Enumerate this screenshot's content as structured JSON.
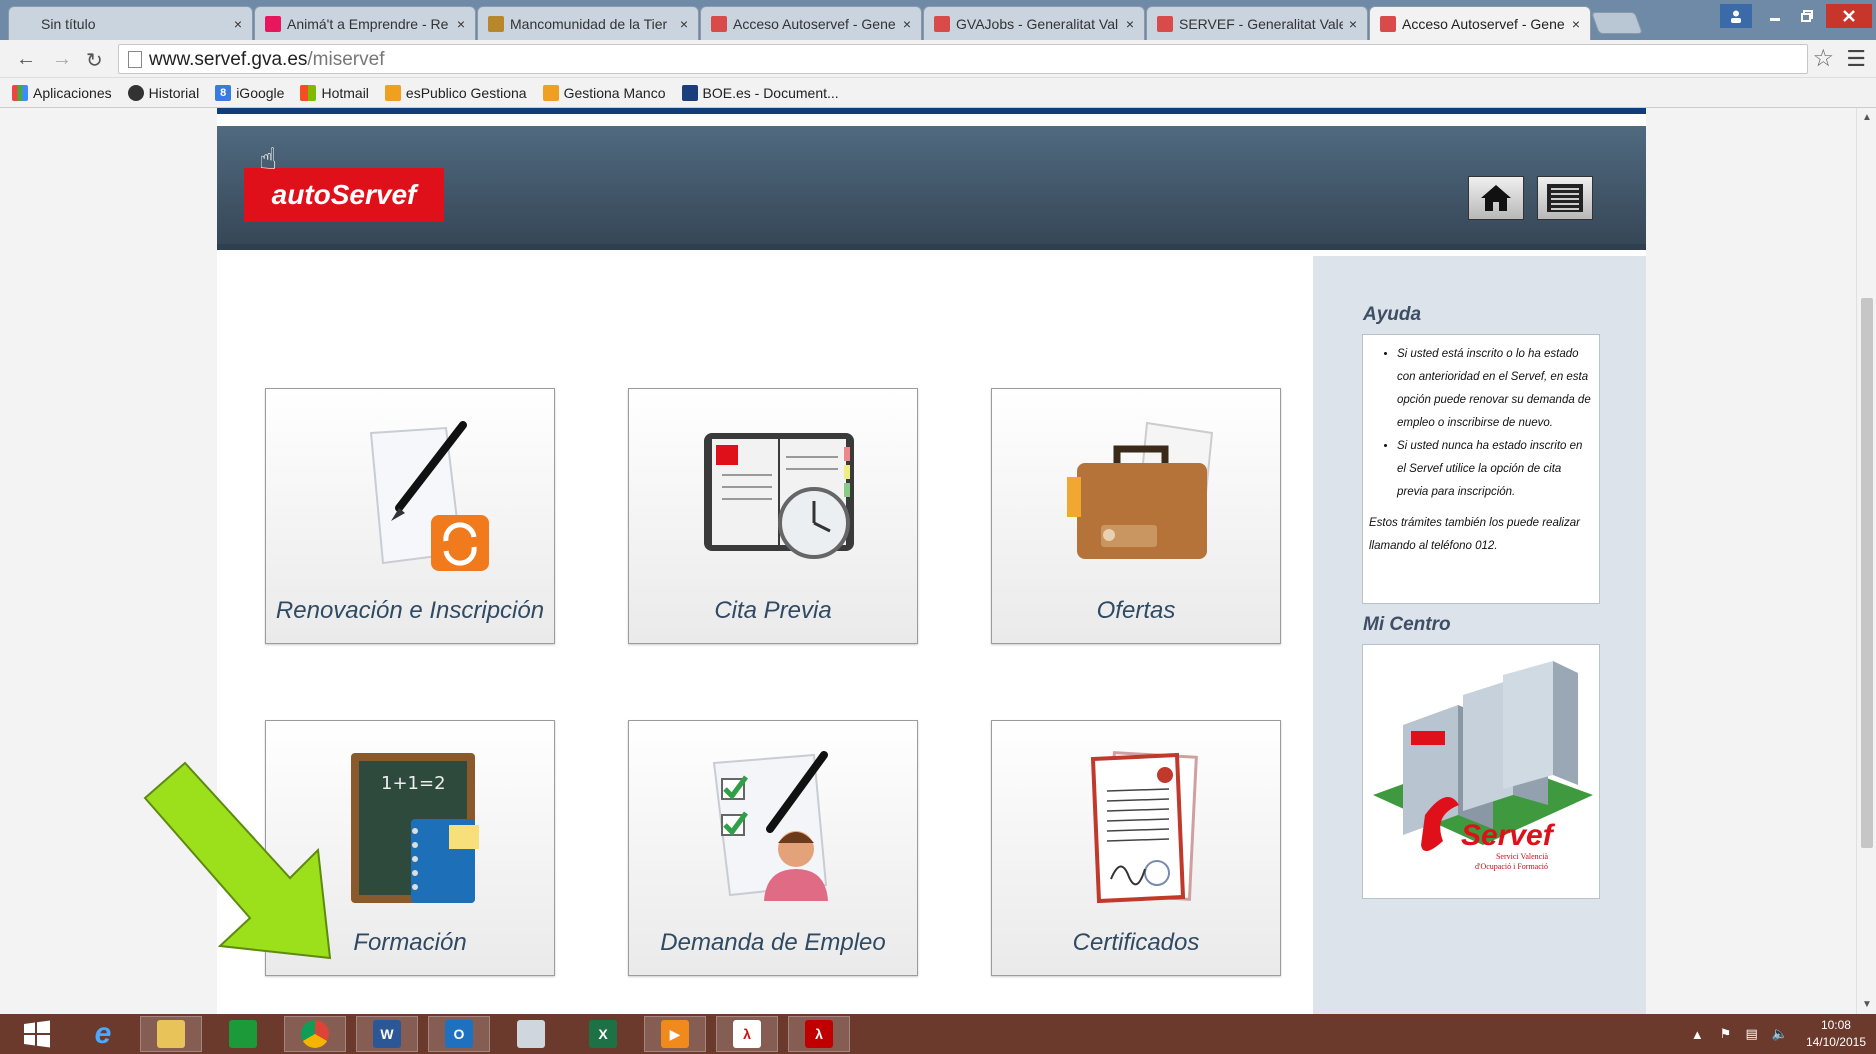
{
  "browser": {
    "tabs": [
      {
        "title": "Sin título",
        "active": false
      },
      {
        "title": "Animá't a Emprendre - Re",
        "active": false
      },
      {
        "title": "Mancomunidad de la Tier",
        "active": false
      },
      {
        "title": "Acceso Autoservef - Gene",
        "active": false
      },
      {
        "title": "GVAJobs - Generalitat Val",
        "active": false
      },
      {
        "title": "SERVEF - Generalitat Valen",
        "active": false
      },
      {
        "title": "Acceso Autoservef - Gene",
        "active": true
      }
    ],
    "close_glyph": "×",
    "url_host": "www.servef.gva.es",
    "url_path": "/miservef",
    "bookmarks": [
      {
        "label": "Aplicaciones",
        "icon": "apps-grid-icon"
      },
      {
        "label": "Historial",
        "icon": "history-icon"
      },
      {
        "label": "iGoogle",
        "icon": "igoogle-icon"
      },
      {
        "label": "Hotmail",
        "icon": "windows-flag-icon"
      },
      {
        "label": "esPublico Gestiona",
        "icon": "espublico-icon"
      },
      {
        "label": "Gestiona Manco",
        "icon": "espublico-icon"
      },
      {
        "label": "BOE.es - Document...",
        "icon": "boe-icon"
      }
    ]
  },
  "site": {
    "logo_text": "autoServef",
    "tiles": [
      {
        "label": "Renovación e Inscripción",
        "icon": "renewal-document-icon"
      },
      {
        "label": "Cita Previa",
        "icon": "agenda-clock-icon"
      },
      {
        "label": "Ofertas",
        "icon": "briefcase-icon"
      },
      {
        "label": "Formación",
        "icon": "chalkboard-icon"
      },
      {
        "label": "Demanda de Empleo",
        "icon": "checklist-person-icon"
      },
      {
        "label": "Certificados",
        "icon": "certificate-icon"
      }
    ],
    "sidebar": {
      "help_title": "Ayuda",
      "help_items": [
        "Si usted está inscrito o lo ha estado con anterioridad en el Servef, en esta opción puede renovar su demanda de empleo o inscribirse de nuevo.",
        "Si usted nunca ha estado inscrito en el Servef utilice la opción de cita previa para inscripción."
      ],
      "help_note": "Estos trámites también los puede realizar llamando al teléfono 012.",
      "centro_title": "Mi Centro",
      "centro_brand": "Servef",
      "centro_sub1": "Servici Valencià",
      "centro_sub2": "d'Ocupació i Formació"
    },
    "colors": {
      "brand_red": "#e0101a",
      "banner": "#44576a",
      "sidebar": "#dde3ea",
      "arrow_green": "#9be01a"
    }
  },
  "taskbar": {
    "time": "10:08",
    "date": "14/10/2015"
  }
}
